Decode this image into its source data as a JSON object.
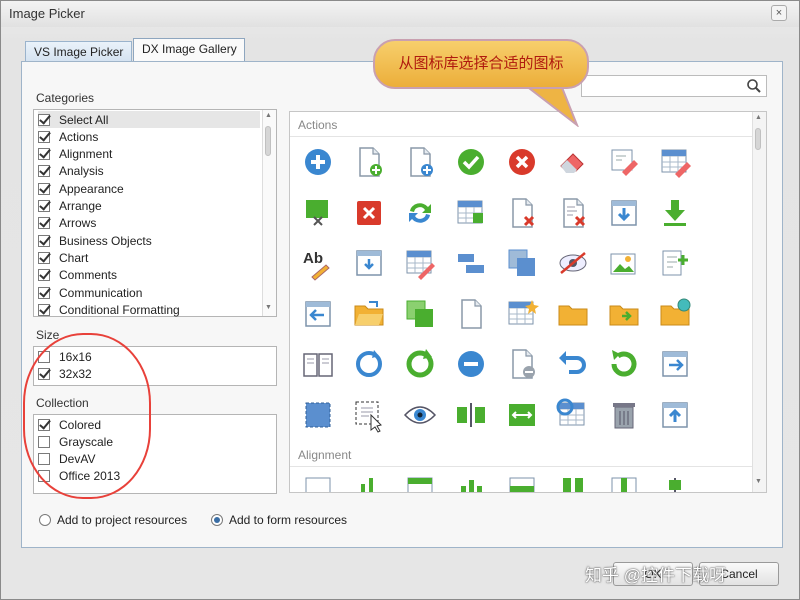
{
  "window": {
    "title": "Image Picker",
    "close_glyph": "×"
  },
  "tabs": [
    {
      "label": "VS Image Picker",
      "active": false
    },
    {
      "label": "DX Image Gallery",
      "active": true
    }
  ],
  "categories": {
    "label": "Categories",
    "items": [
      {
        "label": "Select All",
        "checked": true
      },
      {
        "label": "Actions",
        "checked": true
      },
      {
        "label": "Alignment",
        "checked": true
      },
      {
        "label": "Analysis",
        "checked": true
      },
      {
        "label": "Appearance",
        "checked": true
      },
      {
        "label": "Arrange",
        "checked": true
      },
      {
        "label": "Arrows",
        "checked": true
      },
      {
        "label": "Business Objects",
        "checked": true
      },
      {
        "label": "Chart",
        "checked": true
      },
      {
        "label": "Comments",
        "checked": true
      },
      {
        "label": "Communication",
        "checked": true
      },
      {
        "label": "Conditional Formatting",
        "checked": true
      }
    ]
  },
  "size": {
    "label": "Size",
    "items": [
      {
        "label": "16x16",
        "checked": false
      },
      {
        "label": "32x32",
        "checked": true
      }
    ]
  },
  "collection": {
    "label": "Collection",
    "items": [
      {
        "label": "Colored",
        "checked": true
      },
      {
        "label": "Grayscale",
        "checked": false
      },
      {
        "label": "DevAV",
        "checked": false
      },
      {
        "label": "Office 2013",
        "checked": false
      }
    ]
  },
  "search": {
    "placeholder": "",
    "value": ""
  },
  "gallery": {
    "groups": [
      "Actions",
      "Alignment"
    ],
    "icon_rows": [
      [
        "add-circle-icon",
        "new-document-icon",
        "new-document-alt-icon",
        "apply-check-icon",
        "cancel-circle-icon",
        "eraser-icon",
        "edit-icon",
        "table-edit-icon"
      ],
      [
        "move-green-icon",
        "delete-red-icon",
        "refresh-icon",
        "table-sheet-icon",
        "delete-document-icon",
        "delete-list-icon",
        "download-window-icon",
        "download-arrow-icon"
      ],
      [
        "spelling-icon",
        "window-arrow-icon",
        "table-pencil-icon",
        "bars-icon",
        "copy-windows-icon",
        "hide-icon",
        "picture-icon",
        "list-add-icon"
      ],
      [
        "back-window-icon",
        "open-folder-icon",
        "copy-green-icon",
        "blank-document-icon",
        "table-star-icon",
        "folder-icon",
        "folder-arrow-icon",
        "folder-globe-icon"
      ],
      [
        "book-icon",
        "reset-icon",
        "redo-green-icon",
        "minus-circle-icon",
        "remove-document-icon",
        "undo-icon",
        "rotate-green-icon",
        "forward-window-icon"
      ],
      [
        "select-icon",
        "selection-cursor-icon",
        "view-eye-icon",
        "split-icon",
        "resize-icon",
        "table-refresh-icon",
        "trash-icon",
        "upload-window-icon"
      ]
    ]
  },
  "resources": {
    "options": [
      {
        "label": "Add to project resources",
        "selected": false
      },
      {
        "label": "Add to form resources",
        "selected": true
      }
    ]
  },
  "buttons": {
    "ok": "OK",
    "cancel": "Cancel"
  },
  "annotation": {
    "callout": "从图标库选择合适的图标"
  },
  "watermark": "知乎 @控件下载呀",
  "colors": {
    "accent_blue": "#3a87d0",
    "green": "#4aae2f",
    "red": "#d93a2b",
    "callout_fill": "#f1bb4e",
    "callout_text": "#b01a0e",
    "highlight_ellipse": "#e8413a"
  }
}
